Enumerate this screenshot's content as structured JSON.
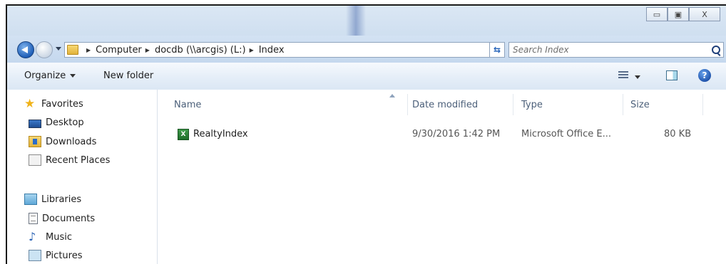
{
  "window": {
    "controls": {
      "minimize_glyph": "▭",
      "maximize_glyph": "▣",
      "close_glyph": "X"
    }
  },
  "address_bar": {
    "breadcrumbs": [
      "Computer",
      "docdb (\\\\arcgis) (L:)",
      "Index"
    ],
    "refresh_glyph": "⇆"
  },
  "search": {
    "placeholder": "Search Index"
  },
  "toolbar": {
    "organize_label": "Organize",
    "new_folder_label": "New folder"
  },
  "help": {
    "glyph": "?"
  },
  "sidebar": {
    "favorites": {
      "label": "Favorites",
      "items": [
        {
          "label": "Desktop",
          "icon": "desktop-icon"
        },
        {
          "label": "Downloads",
          "icon": "downloads-folder-icon"
        },
        {
          "label": "Recent Places",
          "icon": "recent-places-icon"
        }
      ]
    },
    "libraries": {
      "label": "Libraries",
      "items": [
        {
          "label": "Documents",
          "icon": "documents-icon"
        },
        {
          "label": "Music",
          "icon": "music-icon"
        },
        {
          "label": "Pictures",
          "icon": "pictures-icon"
        }
      ]
    }
  },
  "file_list": {
    "columns": [
      "Name",
      "Date modified",
      "Type",
      "Size"
    ],
    "rows": [
      {
        "name": "RealtyIndex",
        "date_modified": "9/30/2016 1:42 PM",
        "type": "Microsoft Office E...",
        "size": "80 KB",
        "icon": "excel-file-icon",
        "icon_glyph": "X"
      }
    ]
  }
}
